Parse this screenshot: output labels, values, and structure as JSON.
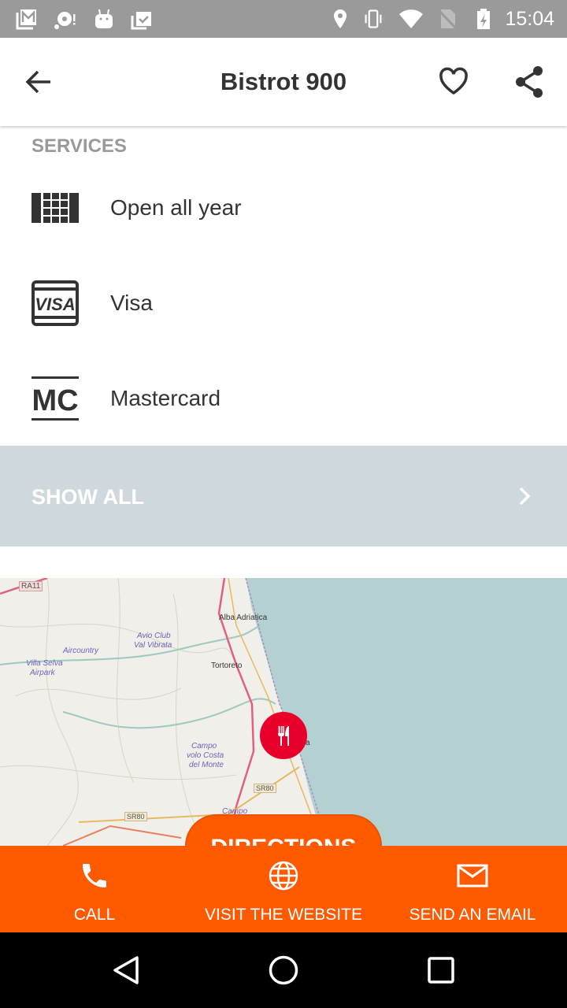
{
  "status_bar": {
    "time": "15:04",
    "icons": [
      "gmail-icon",
      "sync-error-icon",
      "android-icon",
      "clipboard-check-icon",
      "location-icon",
      "vibrate-icon",
      "wifi-icon",
      "no-sim-icon",
      "battery-charging-icon"
    ]
  },
  "app_bar": {
    "title": "Bistrot 900",
    "back_icon": "arrow-back-icon",
    "favorite_icon": "heart-outline-icon",
    "share_icon": "share-icon"
  },
  "services": {
    "heading": "SERVICES",
    "items": [
      {
        "label": "Open all year",
        "icon": "calendar-grid-icon"
      },
      {
        "label": "Visa",
        "icon": "visa-card-icon"
      },
      {
        "label": "Mastercard",
        "icon": "mastercard-icon"
      }
    ],
    "show_all": "SHOW ALL"
  },
  "map": {
    "labels": [
      "RA11",
      "Alba Adriatica",
      "Avio Club",
      "Val Vibrata",
      "Aircountry",
      "Villa Selva",
      "Airpark",
      "Tortoreto",
      "Campo",
      "volo Costa",
      "del Monte",
      "SR80",
      "SR80",
      "Campo",
      "a"
    ],
    "marker_icon": "restaurant-icon",
    "directions": "DIRECTIONS",
    "colors": {
      "sea": "#b5d0d0",
      "land": "#f1efe9",
      "marker": "#e8002a"
    }
  },
  "actions": [
    {
      "label": "CALL",
      "icon": "phone-icon"
    },
    {
      "label": "VISIT THE WEBSITE",
      "icon": "globe-icon"
    },
    {
      "label": "SEND AN EMAIL",
      "icon": "email-icon"
    }
  ],
  "colors": {
    "accent": "#ff5a00",
    "show_all_bg": "#cfd8dc"
  }
}
